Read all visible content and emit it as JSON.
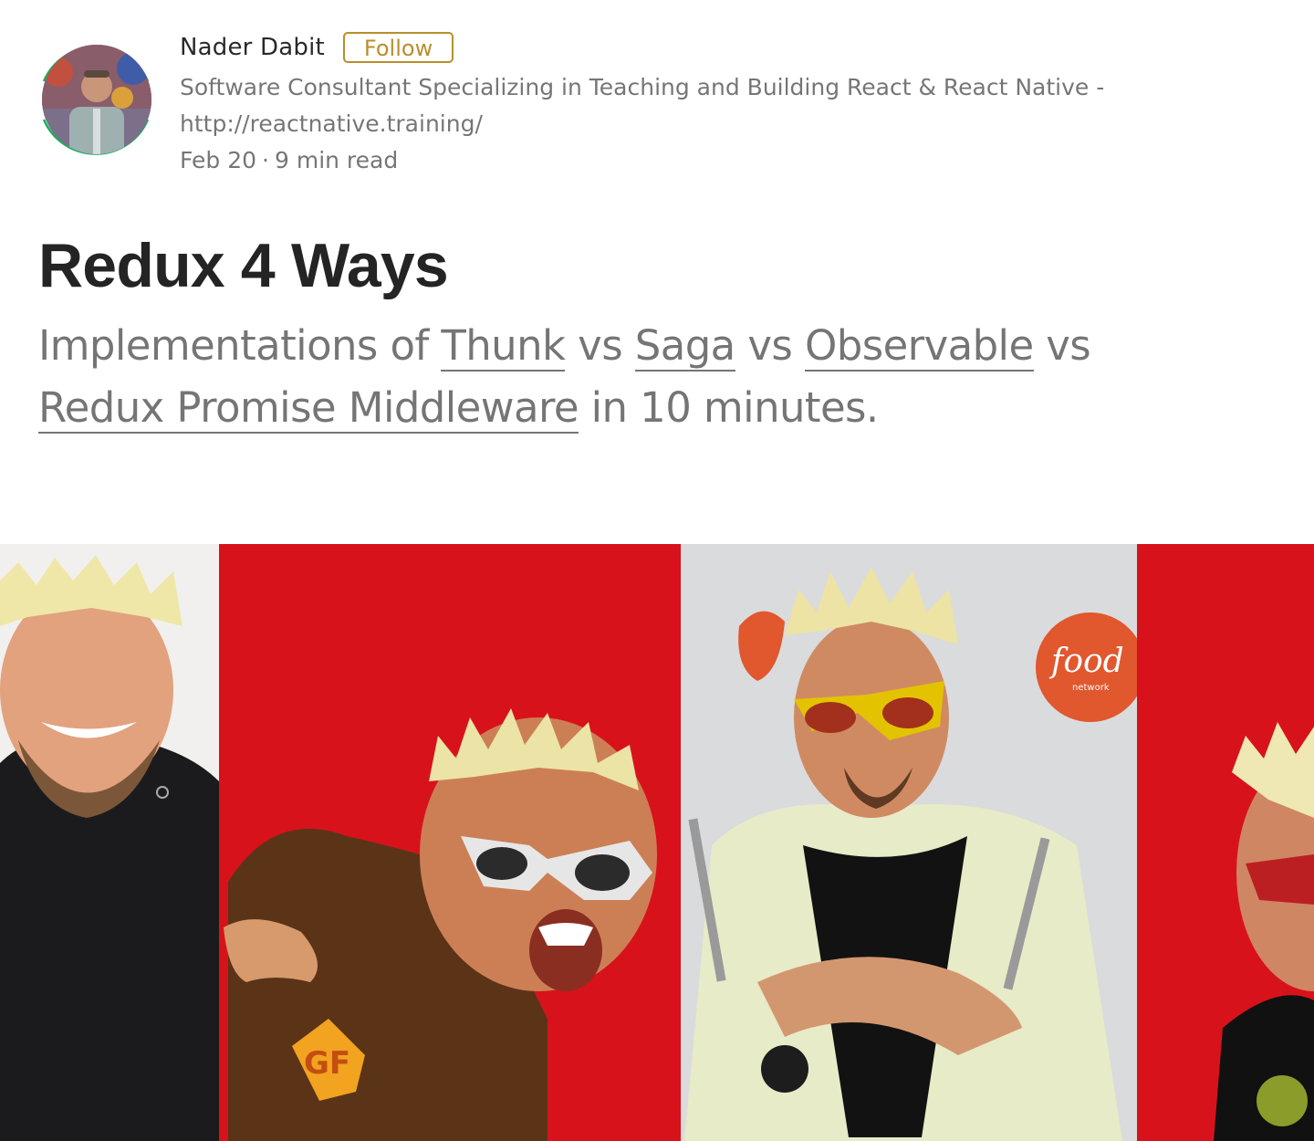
{
  "author": {
    "name": "Nader Dabit",
    "follow_label": "Follow",
    "bio_line1": "Software Consultant Specializing in Teaching and Building React & React Native -",
    "bio_line2": "http://reactnative.training/",
    "date": "Feb 20",
    "separator": "·",
    "read_time": "9 min read"
  },
  "article": {
    "title": "Redux 4 Ways",
    "subtitle": {
      "prefix": "Implementations of ",
      "link1": "Thunk",
      "vs1": " vs ",
      "link2": "Saga",
      "vs2": " vs ",
      "link3": "Observable",
      "vs3": " vs ",
      "link4": "Redux Promise Middleware",
      "suffix": " in 10 minutes."
    }
  },
  "hero_image": {
    "logo_text": "food",
    "logo_subtext": "network",
    "badge_text": "GF"
  },
  "colors": {
    "follow_accent": "#b88f2d",
    "avatar_ring": "#1aaf5d",
    "hero_red": "#d8121b"
  }
}
